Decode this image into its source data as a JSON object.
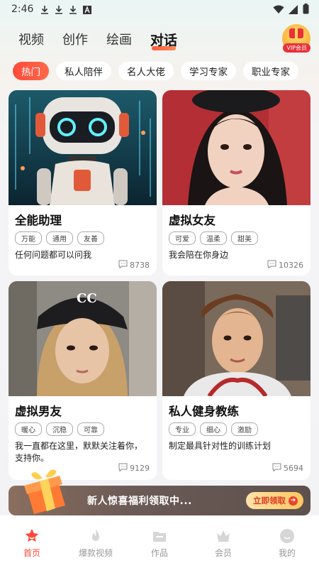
{
  "status_bar": {
    "time": "2:46"
  },
  "top_tabs": [
    {
      "label": "视频"
    },
    {
      "label": "创作"
    },
    {
      "label": "绘画"
    },
    {
      "label": "对话",
      "active": true
    }
  ],
  "vip": {
    "label": "VIP会员"
  },
  "categories": [
    {
      "label": "热门",
      "active": true
    },
    {
      "label": "私人陪伴"
    },
    {
      "label": "名人大佬"
    },
    {
      "label": "学习专家"
    },
    {
      "label": "职业专家"
    }
  ],
  "cards": [
    {
      "title": "全能助理",
      "tags": [
        "万能",
        "通用",
        "友善"
      ],
      "desc": "任何问题都可以问我",
      "count": "8738"
    },
    {
      "title": "虚拟女友",
      "tags": [
        "可爱",
        "温柔",
        "甜美"
      ],
      "desc": "我会陪在你身边",
      "count": "10326"
    },
    {
      "title": "虚拟男友",
      "tags": [
        "暖心",
        "沉稳",
        "可靠"
      ],
      "desc": "我一直都在这里，默默关注着你，支持你。",
      "count": "9129"
    },
    {
      "title": "私人健身教练",
      "tags": [
        "专业",
        "细心",
        "激励"
      ],
      "desc": "制定最具针对性的训练计划",
      "count": "5694"
    }
  ],
  "banner": {
    "text": "新人惊喜福利领取中...",
    "button": "立即领取"
  },
  "bottom_nav": [
    {
      "label": "首页",
      "icon": "home-icon",
      "active": true
    },
    {
      "label": "爆款视频",
      "icon": "flame-icon"
    },
    {
      "label": "作品",
      "icon": "folder-icon"
    },
    {
      "label": "会员",
      "icon": "crown-icon"
    },
    {
      "label": "我的",
      "icon": "profile-icon"
    }
  ],
  "colors": {
    "accent": "#ff4a3a",
    "vip_gold": "#f7a629"
  }
}
